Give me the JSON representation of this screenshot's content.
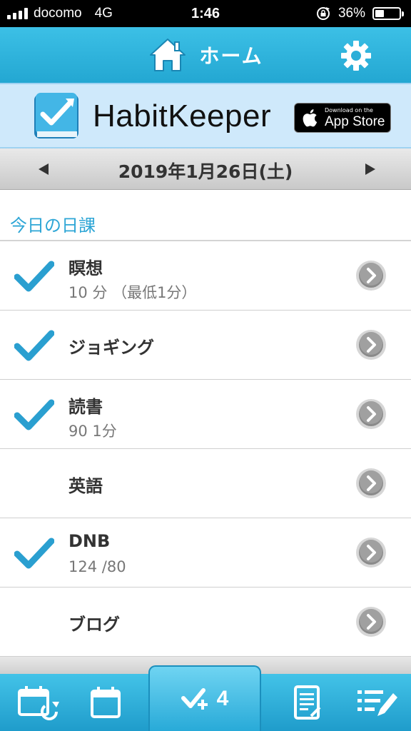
{
  "status_bar": {
    "carrier": "docomo",
    "network": "4G",
    "time": "1:46",
    "battery_percent": "36%",
    "battery_level": 0.36
  },
  "header": {
    "title": "ホーム",
    "home_icon": "home-icon",
    "settings_icon": "gear-icon"
  },
  "banner": {
    "app_name": "HabitKeeper",
    "store_small": "Download on the",
    "store_big": "App Store"
  },
  "date_bar": {
    "date": "2019年1月26日(土)",
    "prev_icon": "triangle-left-icon",
    "next_icon": "triangle-right-icon"
  },
  "section": {
    "title": "今日の日課"
  },
  "habits": [
    {
      "name": "瞑想",
      "detail": "10 分 （最低1分）",
      "checked": true
    },
    {
      "name": "ジョギング",
      "detail": "",
      "checked": true
    },
    {
      "name": "読書",
      "detail": "90 1分",
      "checked": true
    },
    {
      "name": "英語",
      "detail": "",
      "checked": false
    },
    {
      "name": "DNB",
      "detail": "124 /80",
      "checked": true
    },
    {
      "name": "ブログ",
      "detail": "",
      "checked": false
    }
  ],
  "tab_bar": {
    "center_count": "4",
    "tabs": [
      "calendar-repeat-icon",
      "calendar-icon",
      "check-plus-icon",
      "report-icon",
      "edit-list-icon"
    ]
  },
  "colors": {
    "accent": "#23a7d2",
    "check": "#2a9fd0",
    "section_title": "#2ea6d6"
  }
}
